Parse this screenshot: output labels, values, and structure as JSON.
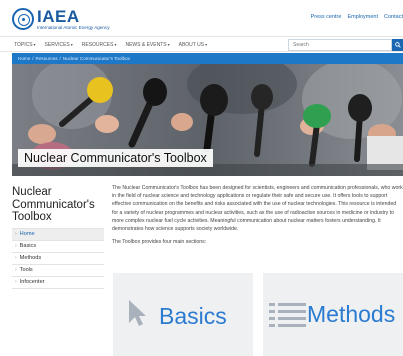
{
  "header": {
    "logo_title": "IAEA",
    "logo_subtitle": "International Atomic Energy Agency",
    "top_links": [
      "Press centre",
      "Employment",
      "Contact"
    ]
  },
  "nav": {
    "items": [
      "TOPICS",
      "SERVICES",
      "RESOURCES",
      "NEWS & EVENTS",
      "ABOUT US"
    ],
    "search_placeholder": "Search"
  },
  "breadcrumb": {
    "items": [
      "Home",
      "Resources",
      "Nuclear Communicator's Toolbox"
    ]
  },
  "hero": {
    "title": "Nuclear Communicator's Toolbox"
  },
  "sidebar": {
    "title": "Nuclear Communicator's Toolbox",
    "items": [
      {
        "label": "Home",
        "active": true
      },
      {
        "label": "Basics",
        "active": false
      },
      {
        "label": "Methods",
        "active": false
      },
      {
        "label": "Tools",
        "active": false
      },
      {
        "label": "Infocenter",
        "active": false
      }
    ]
  },
  "main": {
    "intro": "The Nuclear Communicator's Toolbox has been designed for scientists, engineers and communication professionals, who work in the field of nuclear science and technology applications or regulate their safe and secure use. It offers tools to support effective communication on the benefits and risks associated with the use of nuclear technologies. This resource is intended for a variety of nuclear programmes and nuclear activities, such as the use of radioactive sources in medicine or industry to more complex nuclear fuel cycle activities. Meaningful communication about nuclear matters fosters understanding. It demonstrates how science supports society worldwide.",
    "sections_intro": "The Toolbox provides four main sections:"
  },
  "cards": [
    {
      "label": "Basics",
      "icon": "cursor-arrow-icon"
    },
    {
      "label": "Methods",
      "icon": "list-lines-icon"
    }
  ],
  "colors": {
    "brand": "#1a5aa0",
    "accent": "#1e78c8",
    "card_text": "#2b7bd0",
    "card_bg": "#eef0f2"
  }
}
